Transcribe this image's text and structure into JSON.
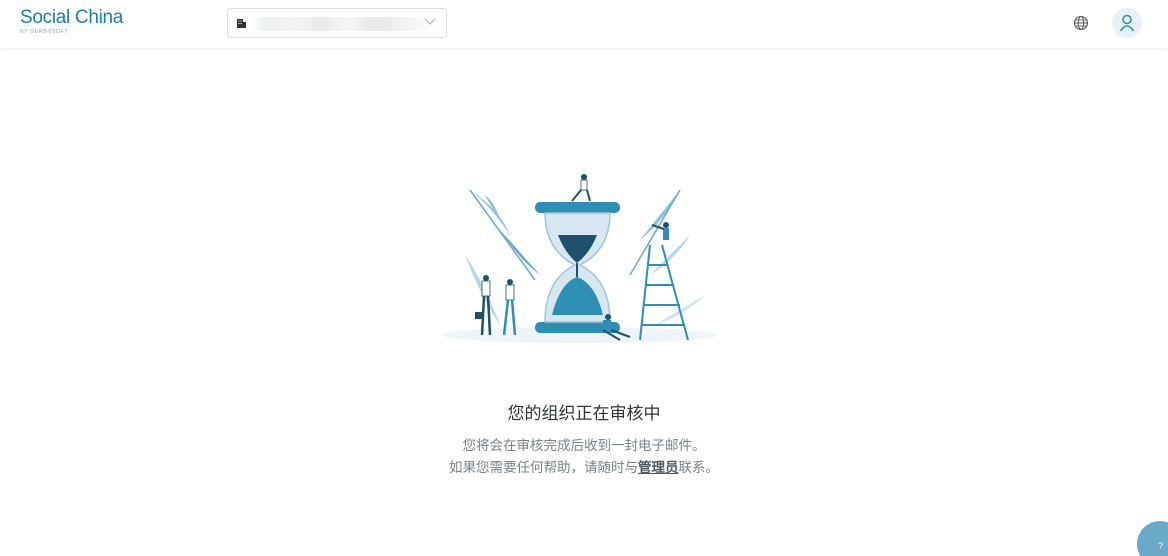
{
  "header": {
    "logo_title": "Social China",
    "logo_subtitle": "BY DERBYSOFT",
    "org_select": {
      "value": "██████████████",
      "icon": "building-icon"
    },
    "globe_icon": "globe-icon",
    "user_icon": "user-icon"
  },
  "main": {
    "illustration": "hourglass-illustration",
    "title": "您的组织正在审核中",
    "line1": "您将会在审核完成后收到一封电子邮件。",
    "line2_before": "如果您需要任何帮助，请随时与",
    "line2_link": "管理员",
    "line2_after": "联系。"
  },
  "help": {
    "label": "?"
  },
  "colors": {
    "brand": "#1b7fa6",
    "accent": "#2f8fb3",
    "dark": "#20506a"
  }
}
